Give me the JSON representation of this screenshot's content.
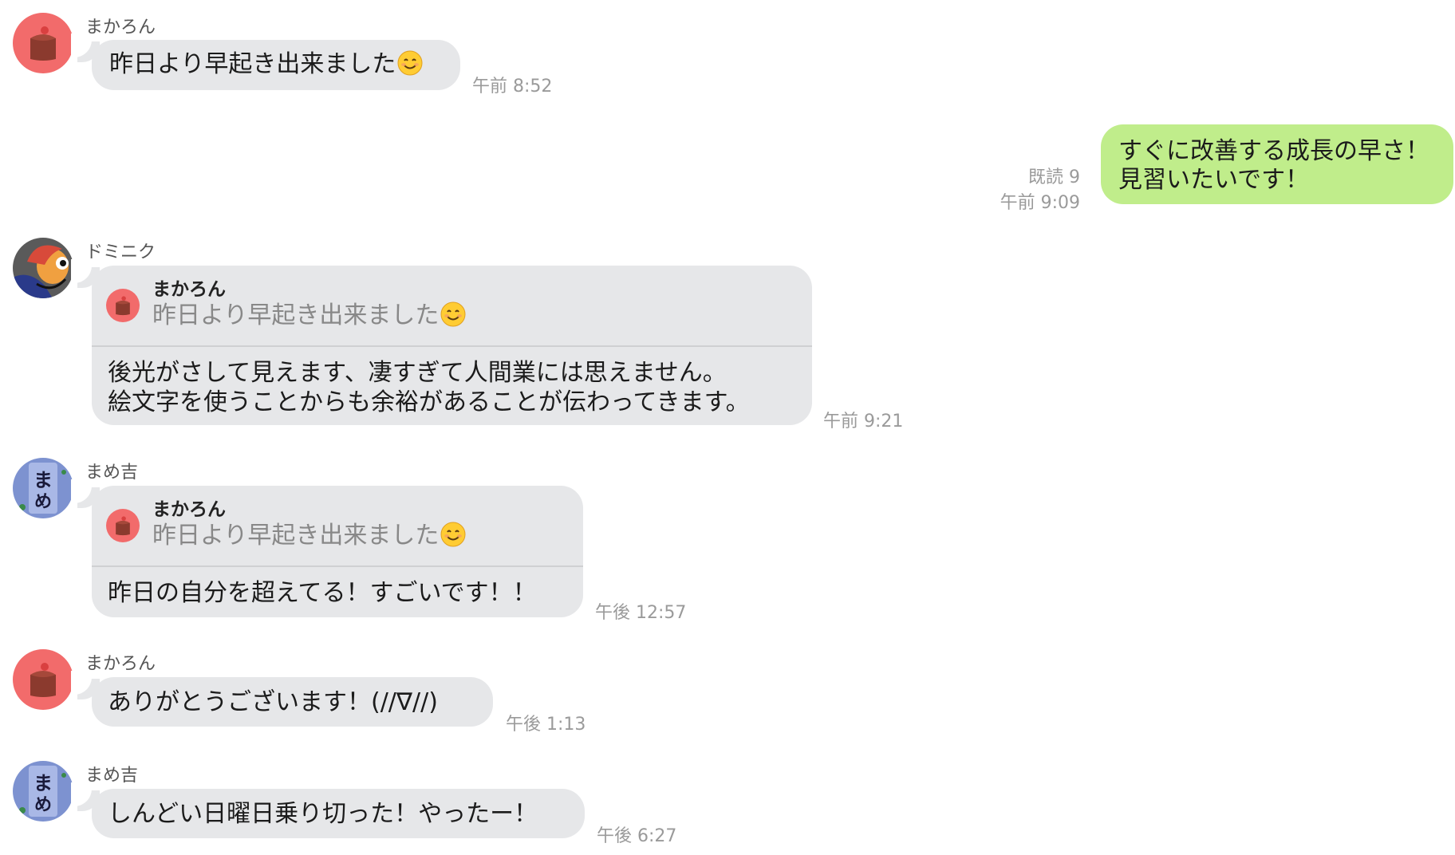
{
  "colors": {
    "incoming_bubble": "#e6e7e9",
    "outgoing_bubble": "#c0ed8b",
    "time_text": "#9a9a9a"
  },
  "messages": [
    {
      "sender": "まかろん",
      "avatar": "cake-icon",
      "text": "昨日より早起き出来ました",
      "emoji": "smiling-face-emoji",
      "time": "午前 8:52"
    },
    {
      "outgoing": true,
      "read": "既読 9",
      "time": "午前 9:09",
      "text": "すぐに改善する成長の早さ！\n見習いたいです！"
    },
    {
      "sender": "ドミニク",
      "avatar": "character-icon",
      "quote": {
        "name": "まかろん",
        "text": "昨日より早起き出来ました",
        "emoji": "smiling-face-emoji"
      },
      "text": "後光がさして見えます、凄すぎて人間業には思えません。\n絵文字を使うことからも余裕があることが伝わってきます。",
      "time": "午前 9:21"
    },
    {
      "sender": "まめ吉",
      "avatar": "mamekichi-icon",
      "quote": {
        "name": "まかろん",
        "text": "昨日より早起き出来ました",
        "emoji": "smiling-face-emoji"
      },
      "text": "昨日の自分を超えてる！すごいです！！",
      "time": "午後 12:57"
    },
    {
      "sender": "まかろん",
      "avatar": "cake-icon",
      "text": "ありがとうございます！(//∇//)",
      "time": "午後 1:13"
    },
    {
      "sender": "まめ吉",
      "avatar": "mamekichi-icon",
      "text": "しんどい日曜日乗り切った！やったー！",
      "time": "午後 6:27"
    }
  ]
}
